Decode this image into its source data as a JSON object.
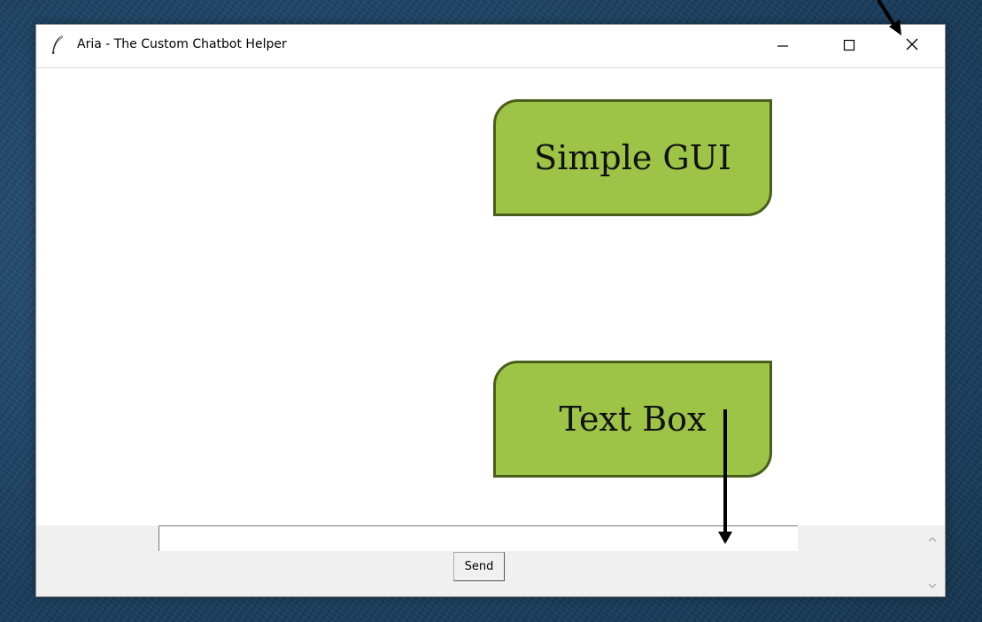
{
  "window": {
    "title": "Aria - The Custom Chatbot Helper",
    "app_icon": "feather-icon",
    "controls": {
      "minimize_icon": "minimize-icon",
      "maximize_icon": "maximize-icon",
      "close_icon": "close-icon"
    }
  },
  "chat": {
    "log_text": "",
    "input_value": "",
    "send_label": "Send"
  },
  "scrollbar": {
    "up_icon": "chevron-up-icon",
    "down_icon": "chevron-down-icon"
  },
  "annotations": {
    "simple_gui_label": "Simple GUI",
    "text_box_label": "Text Box",
    "fill_color": "#9dc446",
    "border_color": "#4a5e1c",
    "arrow_color": "#000000"
  },
  "colors": {
    "background": "#1f4566",
    "window": "#ffffff",
    "panel": "#f0f0f0"
  }
}
